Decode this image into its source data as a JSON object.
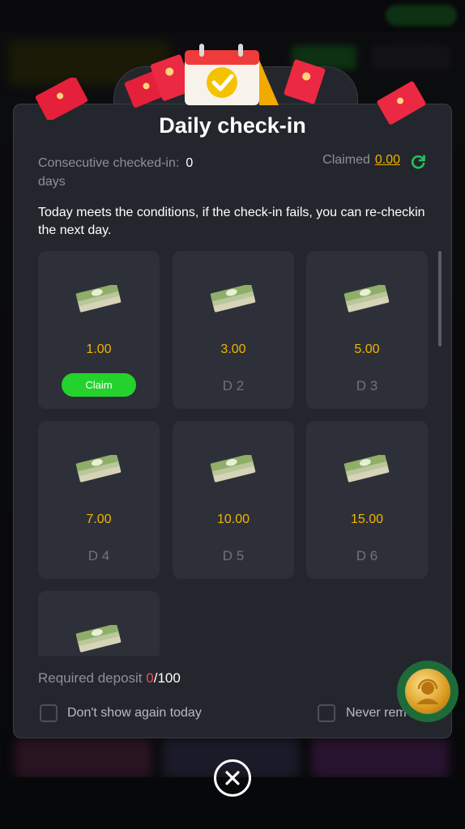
{
  "modal": {
    "title": "Daily check-in",
    "consecutive_label": "Consecutive checked-in:",
    "consecutive_count": "0",
    "consecutive_unit": "days",
    "claimed_label": "Claimed",
    "claimed_amount": "0.00",
    "notice": "Today meets the conditions, if the check-in fails, you can re-checkin the next day.",
    "rewards": [
      {
        "amount": "1.00",
        "day": "",
        "action": "Claim"
      },
      {
        "amount": "3.00",
        "day": "D 2"
      },
      {
        "amount": "5.00",
        "day": "D 3"
      },
      {
        "amount": "7.00",
        "day": "D 4"
      },
      {
        "amount": "10.00",
        "day": "D 5"
      },
      {
        "amount": "15.00",
        "day": "D 6"
      },
      {
        "amount": "",
        "day": ""
      }
    ],
    "deposit_label": "Required deposit ",
    "deposit_current": "0",
    "deposit_required": "/100",
    "dont_show_label": "Don't show again today",
    "never_remind_label": "Never rem"
  },
  "colors": {
    "accent_gold": "#f0b400",
    "claim_green": "#23d32c",
    "deposit_red": "#f24a63",
    "panel": "#24262d",
    "card": "#2e3039"
  },
  "icons": [
    "calendar-check-icon",
    "red-envelope-icon",
    "cash-stack-icon",
    "refresh-icon",
    "support-agent-icon",
    "close-icon"
  ]
}
